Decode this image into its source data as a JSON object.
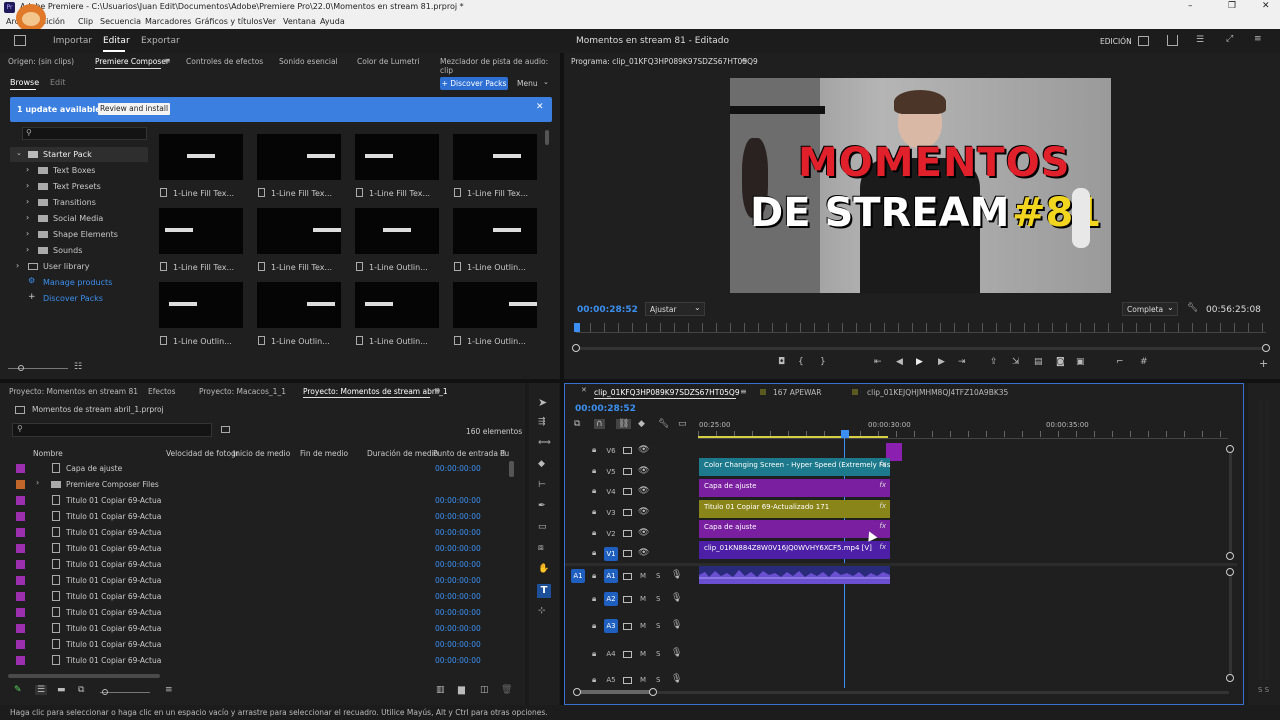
{
  "window": {
    "title": "Adobe Premiere - C:\\Usuarios\\Juan Edit\\Documentos\\Adobe\\Premiere Pro\\22.0\\Momentos en stream 81.prproj *",
    "controls": [
      "–",
      "❐",
      "✕"
    ]
  },
  "menu": [
    "Archivo",
    "Edición",
    "Clip",
    "Secuencia",
    "Marcadores",
    "Gráficos y títulos",
    "Ver",
    "Ventana",
    "Ayuda"
  ],
  "workspace": {
    "tabs": [
      "Importar",
      "Editar",
      "Exportar"
    ],
    "active_tab": "Editar",
    "center_title": "Momentos en stream 81 - Editado",
    "mode": "EDICIÓN"
  },
  "source_panel": {
    "tabs": [
      "Origen: (sin clips)",
      "Premiere Composer",
      "Controles de efectos",
      "Sonido esencial",
      "Color de Lumetri",
      "Mezclador de pista de audio: clip"
    ],
    "subtabs": [
      "Browse",
      "Edit"
    ],
    "discover_btn": "+ Discover Packs",
    "menu_btn": "Menu",
    "banner_text": "1 update available",
    "banner_btn": "Review and install",
    "tree": [
      {
        "label": "Starter Pack",
        "level": 0
      },
      {
        "label": "Text Boxes",
        "level": 1
      },
      {
        "label": "Text Presets",
        "level": 1
      },
      {
        "label": "Transitions",
        "level": 1
      },
      {
        "label": "Social Media",
        "level": 1
      },
      {
        "label": "Shape Elements",
        "level": 1
      },
      {
        "label": "Sounds",
        "level": 1
      },
      {
        "label": "User library",
        "level": 0
      },
      {
        "label": "Manage products",
        "level": 0
      },
      {
        "label": "Discover Packs",
        "level": 0
      }
    ],
    "grid": [
      "1-Line Fill Tex...",
      "1-Line Fill Tex...",
      "1-Line Fill Tex...",
      "1-Line Fill Tex...",
      "1-Line Fill Tex...",
      "1-Line Fill Tex...",
      "1-Line Outlin...",
      "1-Line Outlin...",
      "1-Line Outlin...",
      "1-Line Outlin...",
      "1-Line Outlin...",
      "1-Line Outlin..."
    ]
  },
  "program": {
    "title": "Programa: clip_01KFQ3HP089K97SDZS67HT05Q9",
    "overlay_line1": "MOMENTOS",
    "overlay_line2": "DE STREAM",
    "overlay_num": "#81",
    "timecode": "00:00:28:52",
    "fit": "Ajustar",
    "quality": "Completa",
    "duration": "00:56:25:08"
  },
  "project_panel": {
    "tabs": [
      "Proyecto: Momentos en stream 81",
      "Efectos",
      "Proyecto: Macacos_1_1",
      "Proyecto: Momentos de stream abril_1"
    ],
    "file": "Momentos de stream abril_1.prproj",
    "count": "160 elementos",
    "columns": [
      "Nombre",
      "Velocidad de fotogr",
      "Inicio de medio",
      "Fin de medio",
      "Duración de medio",
      "Punto de entrada d",
      "Pu"
    ],
    "rows": [
      {
        "name": "Capa de ajuste",
        "tc": "00:00:00:00",
        "color": "#9b2fae",
        "folder": false
      },
      {
        "name": "Premiere Composer Files",
        "tc": "",
        "color": "#c0662a",
        "folder": true
      },
      {
        "name": "Titulo 01 Copiar 69-Actualiza",
        "tc": "00:00:00:00",
        "color": "#9b2fae",
        "folder": false
      },
      {
        "name": "Titulo 01 Copiar 69-Actualiza",
        "tc": "00:00:00:00",
        "color": "#9b2fae",
        "folder": false
      },
      {
        "name": "Titulo 01 Copiar 69-Actualiza",
        "tc": "00:00:00:00",
        "color": "#9b2fae",
        "folder": false
      },
      {
        "name": "Titulo 01 Copiar 69-Actualiza",
        "tc": "00:00:00:00",
        "color": "#9b2fae",
        "folder": false
      },
      {
        "name": "Titulo 01 Copiar 69-Actualiza",
        "tc": "00:00:00:00",
        "color": "#9b2fae",
        "folder": false
      },
      {
        "name": "Titulo 01 Copiar 69-Actualiza",
        "tc": "00:00:00:00",
        "color": "#9b2fae",
        "folder": false
      },
      {
        "name": "Titulo 01 Copiar 69-Actualiza",
        "tc": "00:00:00:00",
        "color": "#9b2fae",
        "folder": false
      },
      {
        "name": "Titulo 01 Copiar 69-Actualiza",
        "tc": "00:00:00:00",
        "color": "#9b2fae",
        "folder": false
      },
      {
        "name": "Titulo 01 Copiar 69-Actualiza",
        "tc": "00:00:00:00",
        "color": "#9b2fae",
        "folder": false
      },
      {
        "name": "Titulo 01 Copiar 69-Actualiza",
        "tc": "00:00:00:00",
        "color": "#9b2fae",
        "folder": false
      },
      {
        "name": "Titulo 01 Copiar 69-Actualiza",
        "tc": "00:00:00:00",
        "color": "#9b2fae",
        "folder": false
      }
    ]
  },
  "timeline": {
    "tabs": [
      "clip_01KFQ3HP089K97SDZS67HT05Q9",
      "167 APEWAR",
      "clip_01KEJQHJMHM8QJ4TFZ10A9BK35"
    ],
    "timecode": "00:00:28:52",
    "ruler": [
      "00:25:00",
      "00:00:30:00",
      "00:00:35:00"
    ],
    "video_tracks": [
      "V6",
      "V5",
      "V4",
      "V3",
      "V2",
      "V1"
    ],
    "audio_tracks": [
      "A1",
      "A2",
      "A3",
      "A4",
      "A5"
    ],
    "clips": {
      "v5": "Color Changing Screen - Hyper Speed (Extremely Fast...",
      "v4": "Capa de ajuste",
      "v3": "Titulo 01 Copiar 69-Actualizado 171",
      "v2": "Capa de ajuste",
      "v1": "clip_01KN884Z8W0V16JQ0WVHY6XCF5.mp4 [V]"
    },
    "fx": "fx",
    "ms": "M",
    "ss": "S"
  },
  "status": "Haga clic para seleccionar o haga clic en un espacio vacío y arrastre para seleccionar el recuadro. Utilice Mayús, Alt y Ctrl para otras opciones.",
  "meter": "S S",
  "colors": {
    "accent": "#3b8ff0",
    "teal": "#1c7a8c",
    "purple": "#7a1fa0",
    "olive": "#8a8518",
    "violet": "#4c1fa6",
    "audio": "#6a4fd1"
  }
}
